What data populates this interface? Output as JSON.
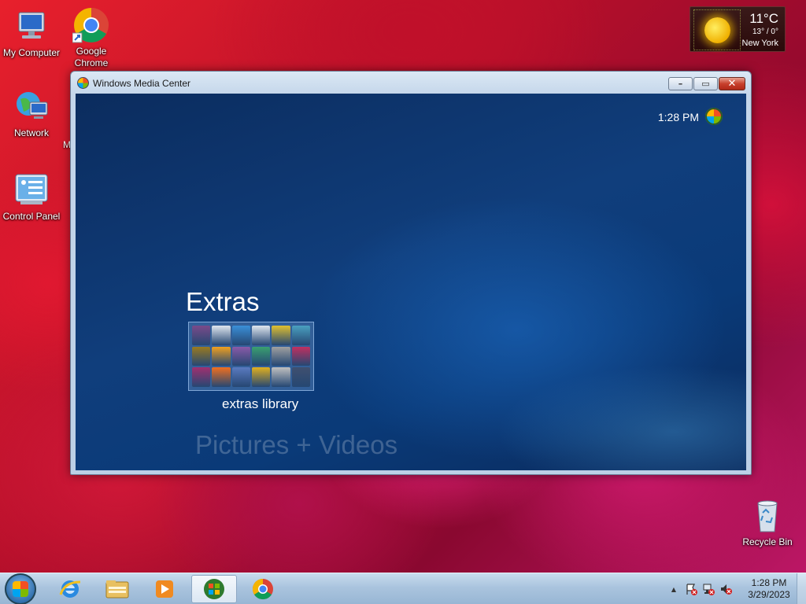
{
  "desktop": {
    "icons": [
      {
        "label": "My Computer",
        "icon": "computer-icon"
      },
      {
        "label": "Google Chrome",
        "icon": "chrome-icon"
      },
      {
        "label": "Network",
        "icon": "network-icon"
      },
      {
        "label": "Control Panel",
        "icon": "control-panel-icon"
      },
      {
        "label": "Recycle Bin",
        "icon": "recycle-bin-icon"
      }
    ],
    "partial_label": "M"
  },
  "weather": {
    "temp": "11°C",
    "range": "13° / 0°",
    "city": "New York",
    "icon": "sun-icon"
  },
  "window": {
    "title": "Windows Media Center",
    "minimize_label": "–",
    "maximize_label": "▭",
    "close_label": "✕"
  },
  "wmc": {
    "clock": "1:28 PM",
    "section_title": "Extras",
    "tile_label": "extras library",
    "next_section": "Pictures + Videos",
    "tile_colors": [
      "#7a4a8a",
      "#dfe6ef",
      "#3a8fd8",
      "#dfe6ef",
      "#e0c030",
      "#4aa0c0",
      "#9a7a20",
      "#f0a020",
      "#8a5aa8",
      "#3aa070",
      "#a0a0a0",
      "#c03060",
      "#a03070",
      "#f07020",
      "#5a7ac0",
      "#e0b020",
      "#c0c0c0",
      "#405070"
    ]
  },
  "taskbar": {
    "apps": [
      {
        "name": "internet-explorer-icon"
      },
      {
        "name": "file-explorer-icon"
      },
      {
        "name": "media-player-icon"
      },
      {
        "name": "windows-media-center-icon",
        "active": true
      },
      {
        "name": "chrome-icon"
      }
    ],
    "time": "1:28 PM",
    "date": "3/29/2023",
    "tray_up": "▲"
  }
}
